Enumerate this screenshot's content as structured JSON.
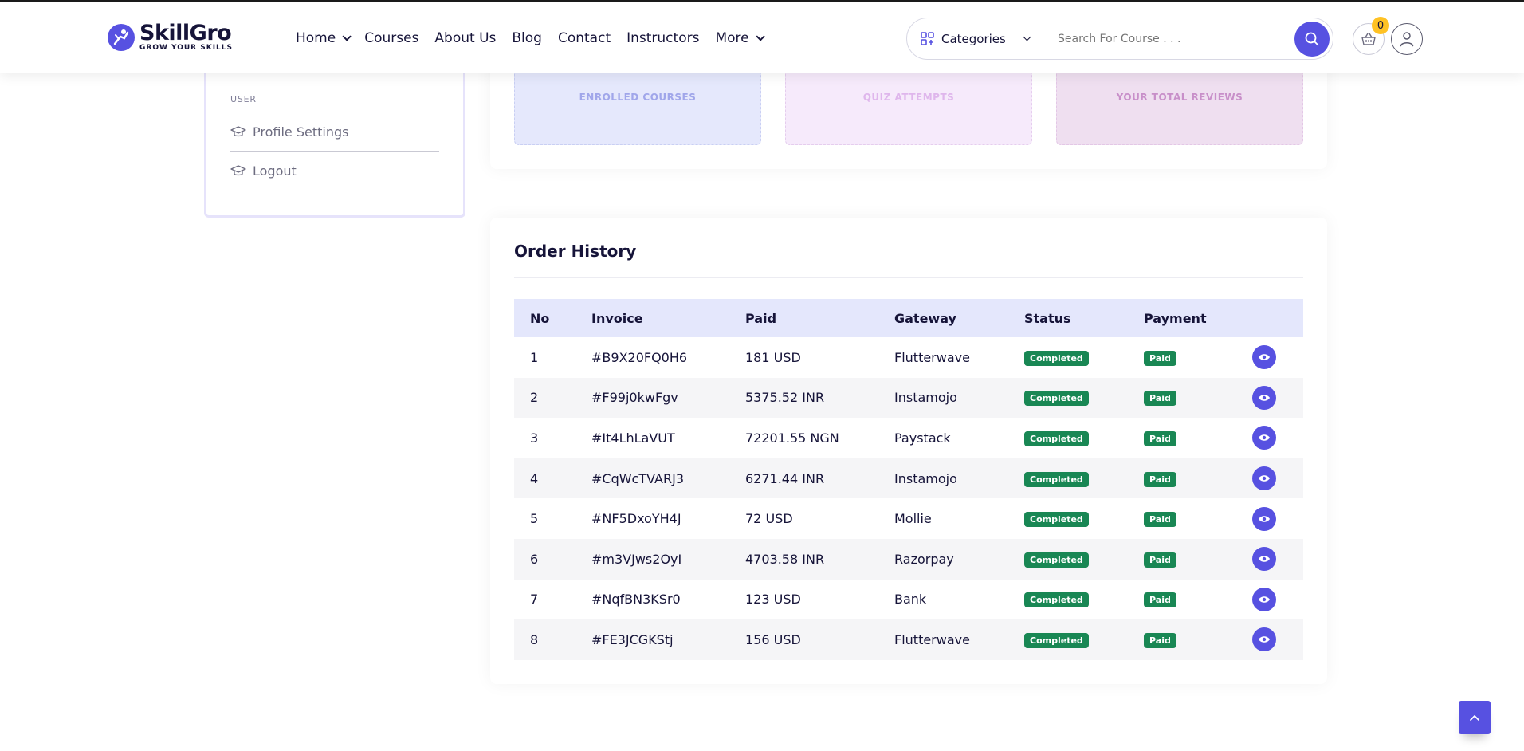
{
  "brand": {
    "name": "SkillGro",
    "tagline": "GROW YOUR SKILLS",
    "accent": "#5751e1"
  },
  "nav": {
    "items": [
      {
        "label": "Home",
        "dropdown": true
      },
      {
        "label": "Courses",
        "dropdown": false
      },
      {
        "label": "About Us",
        "dropdown": false
      },
      {
        "label": "Blog",
        "dropdown": false
      },
      {
        "label": "Contact",
        "dropdown": false
      },
      {
        "label": "Instructors",
        "dropdown": false
      },
      {
        "label": "More",
        "dropdown": true
      }
    ]
  },
  "search": {
    "category_label": "Categories",
    "placeholder": "Search For Course . . ."
  },
  "cart": {
    "count": "0"
  },
  "sidebar": {
    "section_label": "USER",
    "items": [
      {
        "label": "Profile Settings",
        "icon": "graduation-cap-icon"
      },
      {
        "label": "Logout",
        "icon": "graduation-cap-icon"
      }
    ]
  },
  "stats": {
    "enrolled_label": "ENROLLED COURSES",
    "quiz_label": "QUIZ ATTEMPTS",
    "reviews_label": "YOUR TOTAL REVIEWS"
  },
  "orders": {
    "title": "Order History",
    "columns": [
      "No",
      "Invoice",
      "Paid",
      "Gateway",
      "Status",
      "Payment",
      ""
    ],
    "rows": [
      {
        "no": "1",
        "invoice": "#B9X20FQ0H6",
        "paid": "181 USD",
        "gateway": "Flutterwave",
        "status": "Completed",
        "payment": "Paid"
      },
      {
        "no": "2",
        "invoice": "#F99j0kwFgv",
        "paid": "5375.52 INR",
        "gateway": "Instamojo",
        "status": "Completed",
        "payment": "Paid"
      },
      {
        "no": "3",
        "invoice": "#It4LhLaVUT",
        "paid": "72201.55 NGN",
        "gateway": "Paystack",
        "status": "Completed",
        "payment": "Paid"
      },
      {
        "no": "4",
        "invoice": "#CqWcTVARJ3",
        "paid": "6271.44 INR",
        "gateway": "Instamojo",
        "status": "Completed",
        "payment": "Paid"
      },
      {
        "no": "5",
        "invoice": "#NF5DxoYH4J",
        "paid": "72 USD",
        "gateway": "Mollie",
        "status": "Completed",
        "payment": "Paid"
      },
      {
        "no": "6",
        "invoice": "#m3VJws2OyI",
        "paid": "4703.58 INR",
        "gateway": "Razorpay",
        "status": "Completed",
        "payment": "Paid"
      },
      {
        "no": "7",
        "invoice": "#NqfBN3KSr0",
        "paid": "123 USD",
        "gateway": "Bank",
        "status": "Completed",
        "payment": "Paid"
      },
      {
        "no": "8",
        "invoice": "#FE3JCGKStj",
        "paid": "156 USD",
        "gateway": "Flutterwave",
        "status": "Completed",
        "payment": "Paid"
      }
    ]
  },
  "colors": {
    "status_green": "#198754",
    "header_row": "#e4e7fc",
    "cart_badge": "#ffc224"
  }
}
